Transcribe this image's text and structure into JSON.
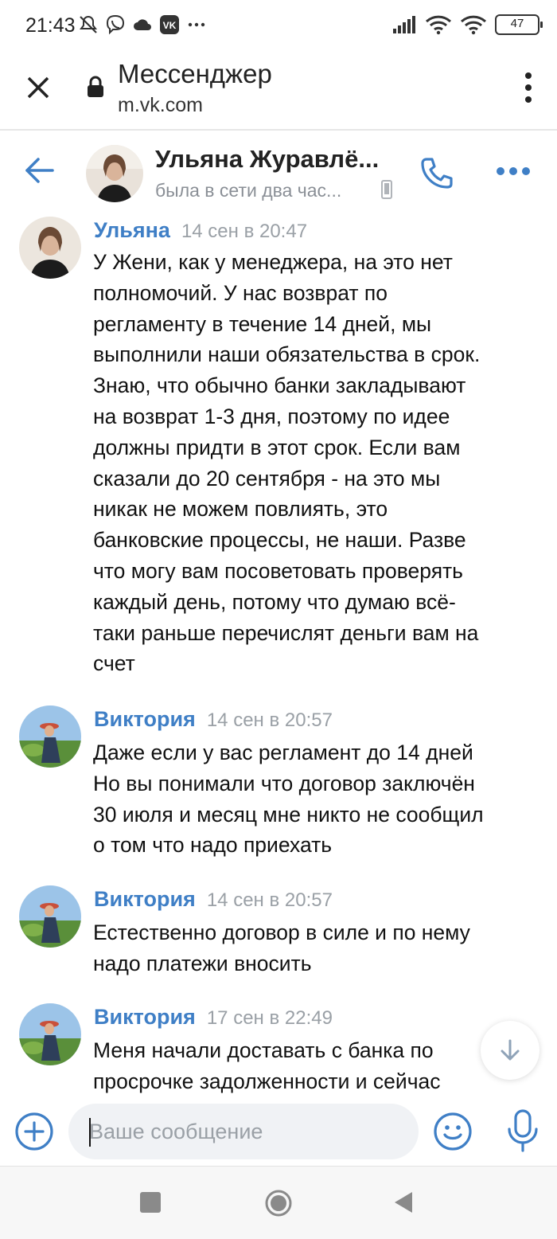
{
  "status_bar": {
    "time": "21:43",
    "battery": "47",
    "icons_left": [
      "mute-notification-icon",
      "viber-icon",
      "cloud-icon",
      "vk-icon",
      "more-dots-icon"
    ],
    "icons_right": [
      "signal-icon",
      "wifi-icon",
      "wifi-icon",
      "battery-icon"
    ]
  },
  "browser": {
    "title": "Мессенджер",
    "url": "m.vk.com"
  },
  "chat_header": {
    "name": "Ульяна Журавлё...",
    "status": "была в сети два час..."
  },
  "colors": {
    "accent": "#3f7fc6",
    "time_gray": "#9aa0a6",
    "input_bg": "#f0f2f5"
  },
  "messages": [
    {
      "author": "Ульяна",
      "time": "14 сен в 20:47",
      "lines": [
        "У Жени, как у менеджера, на это нет",
        "полномочий. У нас возврат по",
        "регламенту в течение 14 дней, мы",
        "выполнили наши обязательства в срок.",
        "Знаю, что обычно банки закладывают",
        "на возврат 1-3 дня, поэтому по идее",
        "должны придти в этот срок. Если вам",
        "сказали до 20 сентября - на это мы",
        "никак не можем повлиять, это",
        "банковские процессы, не наши. Разве",
        "что могу вам посоветовать проверять",
        "каждый день, потому что думаю всё-",
        "таки раньше перечислят деньги вам на",
        "счет"
      ]
    },
    {
      "author": "Виктория",
      "time": "14 сен в 20:57",
      "lines": [
        "Даже если у вас регламент до 14 дней",
        "Но вы понимали что договор заключён",
        "30 июля и месяц мне никто не сообщил",
        "о том что надо приехать"
      ]
    },
    {
      "author": "Виктория",
      "time": "14 сен в 20:57",
      "lines": [
        "Естественно договор в силе и по нему",
        "надо платежи вносить"
      ]
    },
    {
      "author": "Виктория",
      "time": "17 сен в 22:49",
      "lines": [
        "Меня начали доставать с банка по",
        "просрочке задолженности и сейчас"
      ]
    }
  ],
  "composer": {
    "placeholder": "Ваше сообщение",
    "value": ""
  }
}
